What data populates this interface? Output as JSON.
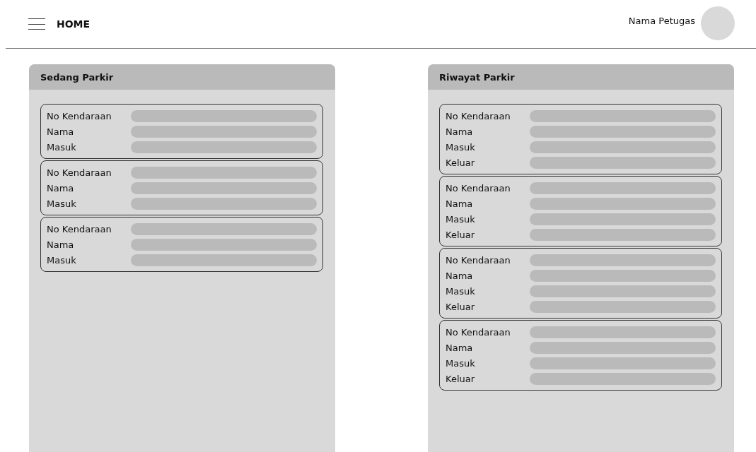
{
  "header": {
    "title": "HOME",
    "user_name": "Nama Petugas"
  },
  "panels": [
    {
      "title": "Sedang Parkir",
      "cards": [
        {
          "fields": [
            "No Kendaraan",
            "Nama",
            "Masuk"
          ]
        },
        {
          "fields": [
            "No Kendaraan",
            "Nama",
            "Masuk"
          ]
        },
        {
          "fields": [
            "No Kendaraan",
            "Nama",
            "Masuk"
          ]
        }
      ]
    },
    {
      "title": "Riwayat Parkir",
      "cards": [
        {
          "fields": [
            "No Kendaraan",
            "Nama",
            "Masuk",
            "Keluar"
          ]
        },
        {
          "fields": [
            "No Kendaraan",
            "Nama",
            "Masuk",
            "Keluar"
          ]
        },
        {
          "fields": [
            "No Kendaraan",
            "Nama",
            "Masuk",
            "Keluar"
          ]
        },
        {
          "fields": [
            "No Kendaraan",
            "Nama",
            "Masuk",
            "Keluar"
          ]
        }
      ]
    }
  ]
}
